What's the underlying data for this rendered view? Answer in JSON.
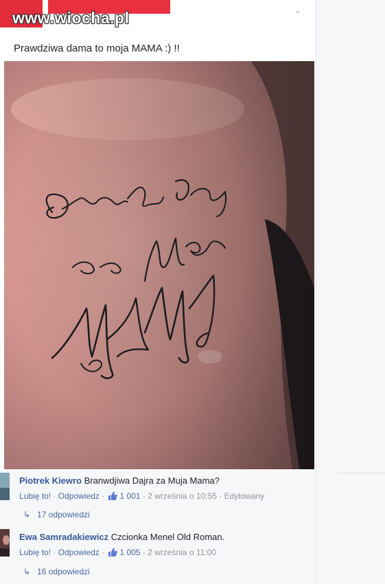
{
  "watermark": "www.wiocha.pl",
  "post": {
    "meta": "· • ·",
    "caption": "Prawdziwa dama to moja MAMA :) !!"
  },
  "tattoo": {
    "line1": "Branwdjiwa Dama",
    "line2": "za Moja",
    "line3": "MAMA"
  },
  "comments": [
    {
      "author": "Piotrek Kiewro",
      "text": "Branwdjiwa Dajra za Muja Mama?",
      "like_label": "Lubię to!",
      "reply_label": "Odpowiedz",
      "likes": "1 001",
      "date": "2 września o 10:55",
      "edited": "Edytowany",
      "replies": "17 odpowiedzi"
    },
    {
      "author": "Ewa Samradakiewicz",
      "text": "Czcionka Menel Old Roman.",
      "like_label": "Lubię to!",
      "reply_label": "Odpowiedz",
      "likes": "1 005",
      "date": "2 września o 11:00",
      "edited": "",
      "replies": "16 odpowiedzi"
    }
  ],
  "colors": {
    "link": "#365899",
    "redaction": "#e8303f",
    "ink": "#1b1b1f"
  }
}
